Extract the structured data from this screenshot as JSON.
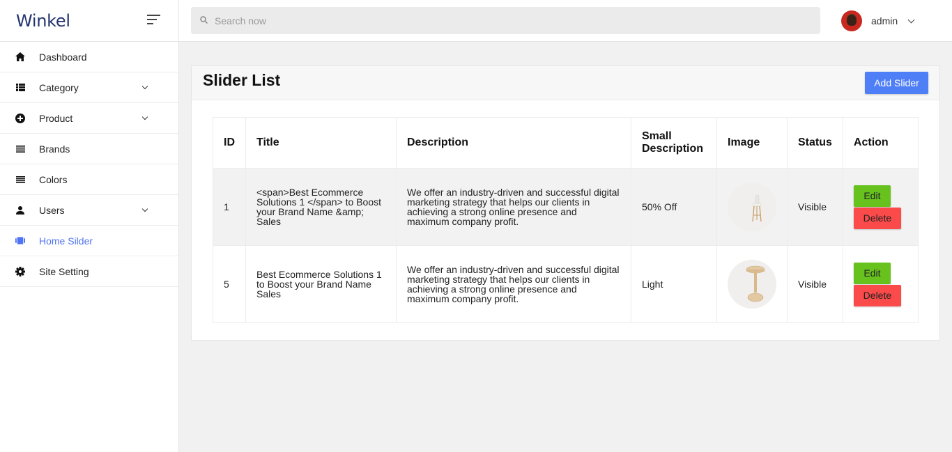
{
  "brand": {
    "name": "Winkel"
  },
  "search": {
    "placeholder": "Search now"
  },
  "user": {
    "name": "admin"
  },
  "sidebar": {
    "items": [
      {
        "label": "Dashboard",
        "icon": "home-icon"
      },
      {
        "label": "Category",
        "icon": "list-icon",
        "expandable": true
      },
      {
        "label": "Product",
        "icon": "plus-circle-icon",
        "expandable": true
      },
      {
        "label": "Brands",
        "icon": "lines-icon"
      },
      {
        "label": "Colors",
        "icon": "lines-icon"
      },
      {
        "label": "Users",
        "icon": "person-icon",
        "expandable": true
      },
      {
        "label": "Home Silder",
        "icon": "slider-icon",
        "active": true
      },
      {
        "label": "Site Setting",
        "icon": "gear-icon"
      }
    ]
  },
  "page": {
    "title": "Slider List",
    "add_button": "Add Slider"
  },
  "table": {
    "headers": [
      "ID",
      "Title",
      "Description",
      "Small Description",
      "Image",
      "Status",
      "Action"
    ],
    "rows": [
      {
        "id": "1",
        "title": "<span>Best Ecommerce Solutions 1 </span> to Boost your Brand Name &amp; Sales",
        "description": "We offer an industry-driven and successful digital marketing strategy that helps our clients in achieving a strong online presence and maximum company profit.",
        "small_description": "50% Off",
        "image": "bar-stool",
        "status": "Visible",
        "edit": "Edit",
        "delete": "Delete"
      },
      {
        "id": "5",
        "title": "Best Ecommerce Solutions 1 to Boost your Brand Name Sales",
        "description": "We offer an industry-driven and successful digital marketing strategy that helps our clients in achieving a strong online presence and maximum company profit.",
        "small_description": "Light",
        "image": "wooden-side-table",
        "status": "Visible",
        "edit": "Edit",
        "delete": "Delete"
      }
    ]
  },
  "colors": {
    "accent": "#4f73f5",
    "brand": "#24356f",
    "edit": "#67c21d",
    "delete": "#fa4a4a"
  }
}
